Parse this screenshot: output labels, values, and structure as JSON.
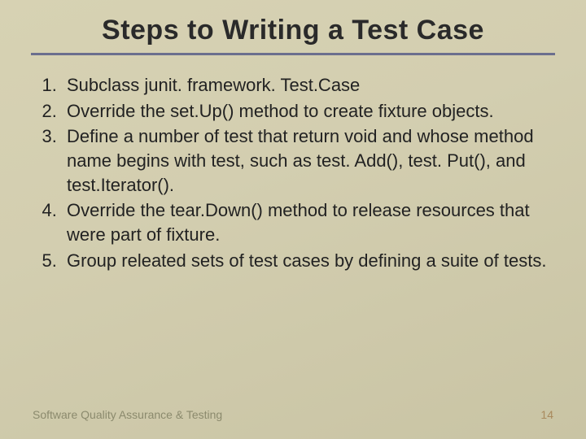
{
  "title": "Steps to Writing a Test Case",
  "items": [
    "Subclass junit. framework. Test.Case",
    "Override the set.Up() method to create fixture objects.",
    "Define a number of test that return void and whose method name begins with test, such as test. Add(), test. Put(), and test.Iterator().",
    "Override the tear.Down() method to release resources that were part of fixture.",
    "Group releated sets of test cases by defining a suite of tests."
  ],
  "footer": {
    "left": "Software Quality Assurance & Testing",
    "right": "14"
  }
}
